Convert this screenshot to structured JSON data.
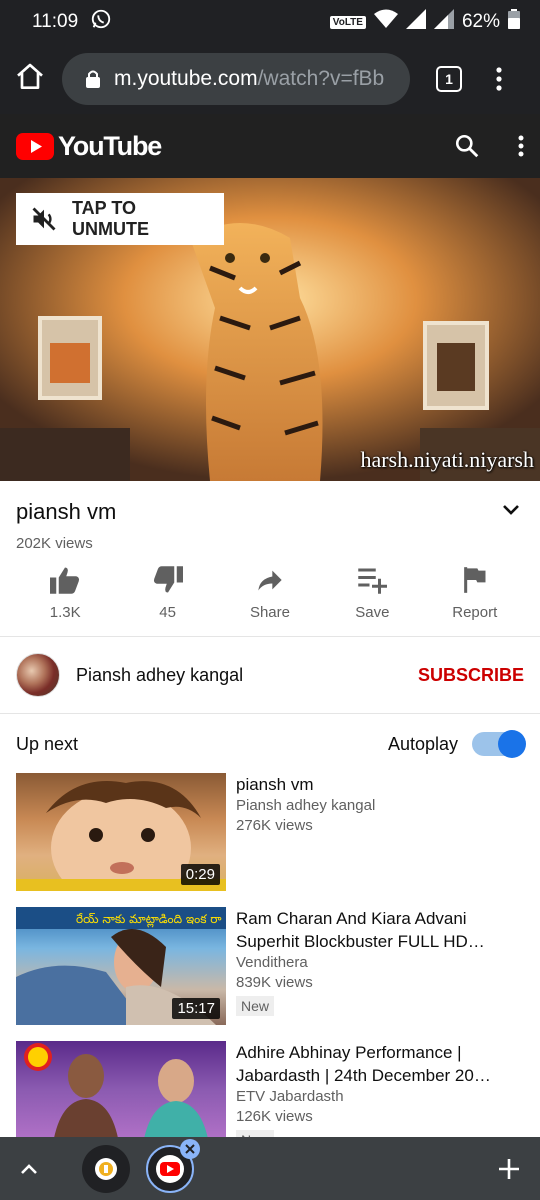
{
  "status_bar": {
    "time": "11:09",
    "volte": "VoLTE",
    "battery": "62%"
  },
  "browser": {
    "url_host": "m.youtube.com",
    "url_path": "/watch?v=fBb",
    "tab_count": "1"
  },
  "youtube": {
    "brand": "YouTube"
  },
  "player": {
    "unmute_label": "TAP TO UNMUTE",
    "watermark": "harsh.niyati.niyarsh"
  },
  "video": {
    "title": "piansh vm",
    "views": "202K views"
  },
  "actions": {
    "like": "1.3K",
    "dislike": "45",
    "share": "Share",
    "save": "Save",
    "report": "Report"
  },
  "channel": {
    "name": "Piansh adhey kangal",
    "subscribe": "SUBSCRIBE"
  },
  "upnext": {
    "label": "Up next",
    "autoplay": "Autoplay",
    "autoplay_on": true
  },
  "videos": [
    {
      "title": "piansh vm",
      "channel": "Piansh adhey kangal",
      "views": "276K views",
      "duration": "0:29",
      "badge": ""
    },
    {
      "title": "Ram Charan And Kiara Advani Superhit Blockbuster FULL HD…",
      "channel": "Vendithera",
      "views": "839K views",
      "duration": "15:17",
      "badge": "New"
    },
    {
      "title": "Adhire Abhinay Performance | Jabardasth | 24th December 20…",
      "channel": "ETV Jabardasth",
      "views": "126K views",
      "duration": "",
      "badge": "New"
    }
  ],
  "colors": {
    "yt_red": "#ff0000",
    "subscribe_red": "#cc0000",
    "toggle_blue": "#1a73e8"
  }
}
